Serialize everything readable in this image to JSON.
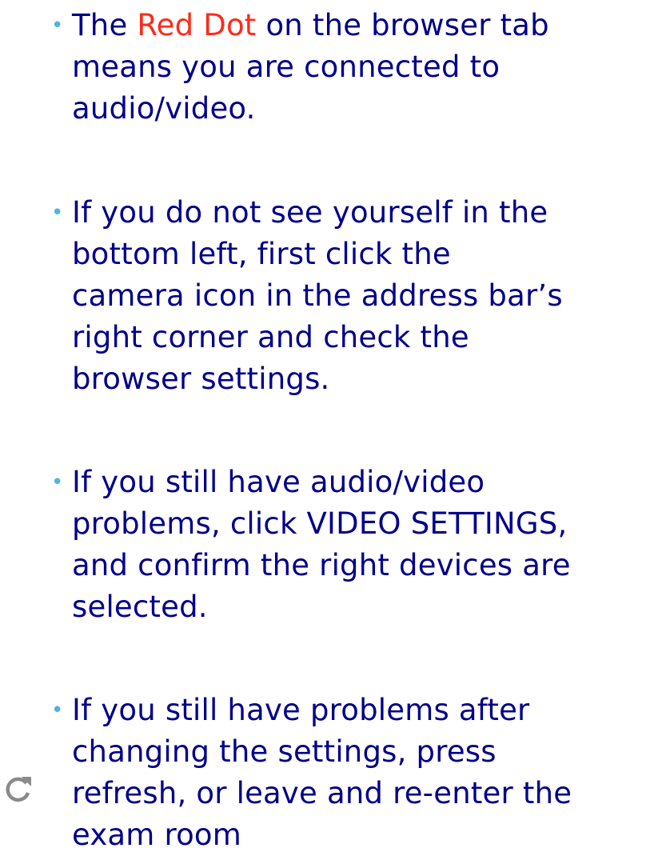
{
  "colors": {
    "text": "#00008b",
    "bullet": "#4fb3e0",
    "highlight": "#ff2a1a",
    "icon": "#8a8a8a"
  },
  "bullets": [
    {
      "marker": "•",
      "lines": [
        {
          "before": "The ",
          "highlight": "Red Dot",
          "after": " on the browser tab"
        },
        {
          "text": "means you are connected to"
        },
        {
          "text": "audio/video."
        }
      ]
    },
    {
      "marker": "•",
      "lines": [
        {
          "text": "If you do not see yourself in the"
        },
        {
          "text": "bottom left, first click the"
        },
        {
          "text": "camera icon in the address bar’s"
        },
        {
          "text": "right corner and check the"
        },
        {
          "text": "browser settings."
        }
      ]
    },
    {
      "marker": "•",
      "lines": [
        {
          "text": "If you still have audio/video"
        },
        {
          "text": "problems, click VIDEO SETTINGS,"
        },
        {
          "text": "and confirm the right devices are"
        },
        {
          "text": "selected."
        }
      ]
    },
    {
      "marker": "•",
      "lines": [
        {
          "text": "If you still have problems after"
        },
        {
          "text": "changing the settings, press"
        },
        {
          "text": "refresh, or leave and re-enter the"
        },
        {
          "text": "exam room"
        }
      ]
    }
  ],
  "icons": {
    "refresh": "refresh-icon"
  }
}
